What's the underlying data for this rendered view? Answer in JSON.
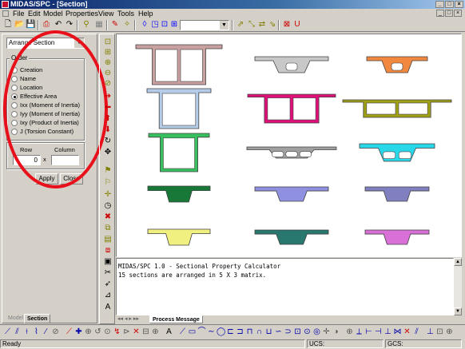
{
  "window": {
    "title": "MIDAS/SPC - [Section]",
    "controls": [
      "_",
      "□",
      "×"
    ]
  },
  "menu": {
    "items": [
      "File",
      "Edit",
      "Model",
      "Properties",
      "View",
      "Tools",
      "Help"
    ],
    "mdi_controls": [
      "_",
      "□",
      "×"
    ]
  },
  "panel": {
    "dropdown_value": "Arrange Section",
    "order_label": "Order",
    "options": [
      "Creation",
      "Name",
      "Location",
      "Effective Area",
      "Ixx (Moment of Inertia)",
      "Iyy (Moment of Inertia)",
      "Ixy (Product of Inertia)",
      "J (Torsion Constant)"
    ],
    "selected_index": 3,
    "row_label": "Row",
    "column_label": "Column",
    "row_value": "0",
    "times": "x",
    "column_value": "",
    "apply_label": "Apply",
    "close_label": "Close",
    "tabs": [
      "Model",
      "Section"
    ],
    "active_tab": "Section"
  },
  "sections": [
    {
      "shape": "box2",
      "color": "#c8a0a0"
    },
    {
      "shape": "hole1",
      "color": "#c8c8c8"
    },
    {
      "shape": "hole1",
      "color": "#f08840"
    },
    {
      "shape": "box1",
      "color": "#b4cce8"
    },
    {
      "shape": "box2",
      "color": "#e0107a"
    },
    {
      "shape": "box2",
      "color": "#a0a018"
    },
    {
      "shape": "box1",
      "color": "#38c060"
    },
    {
      "shape": "hole3",
      "color": "#a0a0a0"
    },
    {
      "shape": "hole2",
      "color": "#28d8e8"
    },
    {
      "shape": "tee",
      "color": "#187838"
    },
    {
      "shape": "tee",
      "color": "#9090e0"
    },
    {
      "shape": "tee",
      "color": "#8080c0"
    },
    {
      "shape": "tee",
      "color": "#f0f080"
    },
    {
      "shape": "tee",
      "color": "#287870"
    },
    {
      "shape": "tee",
      "color": "#d870d8"
    }
  ],
  "messages": {
    "lines": [
      "MIDAS/SPC 1.0 - Sectional Property Calculator",
      "15 sections are arranged in 5 X 3 matrix."
    ],
    "tab": "Process Message"
  },
  "status": {
    "ready": "Ready",
    "ucs": "UCS:",
    "gcs": "GCS:"
  },
  "annotation_color": "#e8101a"
}
